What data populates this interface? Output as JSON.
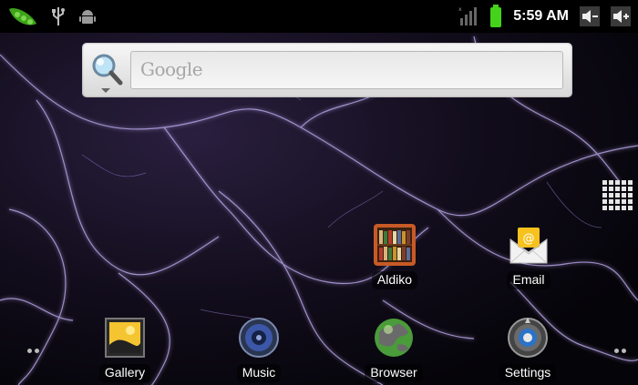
{
  "status_bar": {
    "time": "5:59 AM",
    "icons": [
      "peapod-notification-icon",
      "usb-icon",
      "android-debug-icon",
      "signal-icon",
      "battery-icon",
      "volume-down-icon",
      "volume-up-icon"
    ]
  },
  "search": {
    "placeholder": "Google"
  },
  "apps": {
    "aldiko": {
      "label": "Aldiko"
    },
    "email": {
      "label": "Email"
    },
    "gallery": {
      "label": "Gallery"
    },
    "music": {
      "label": "Music"
    },
    "browser": {
      "label": "Browser"
    },
    "settings": {
      "label": "Settings"
    }
  },
  "colors": {
    "wallpaper": "#120d1c",
    "lightning": "#b8a6e8",
    "battery": "#44d21a"
  }
}
